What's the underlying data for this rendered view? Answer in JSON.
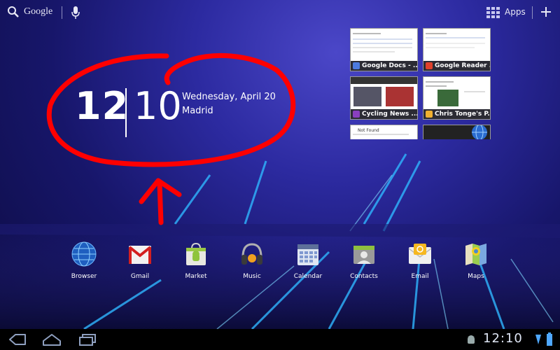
{
  "topbar": {
    "search_label": "Google",
    "apps_label": "Apps"
  },
  "clock": {
    "hour": "12",
    "minute": "10",
    "date": "Wednesday, April 20",
    "city": "Madrid"
  },
  "recent": [
    {
      "title": "Google Docs - ..."
    },
    {
      "title": "Google Reader ..."
    },
    {
      "title": "Cycling News ..."
    },
    {
      "title": "Chris Tonge's P..."
    },
    {
      "title": "Not Found"
    }
  ],
  "dock": {
    "apps": [
      {
        "label": "Browser"
      },
      {
        "label": "Gmail"
      },
      {
        "label": "Market"
      },
      {
        "label": "Music"
      },
      {
        "label": "Calendar"
      },
      {
        "label": "Contacts"
      },
      {
        "label": "Email"
      },
      {
        "label": "Maps"
      }
    ]
  },
  "statusbar": {
    "time": "12:10"
  },
  "colors": {
    "annotation": "#ff0000",
    "background": "#2c2aa0"
  }
}
